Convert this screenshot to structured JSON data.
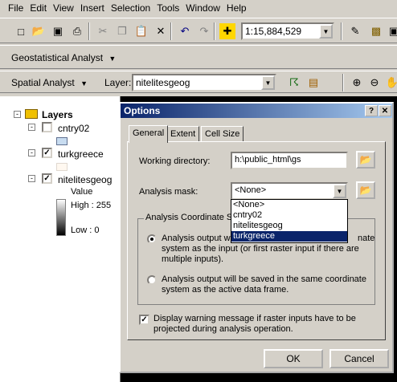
{
  "menu": [
    "File",
    "Edit",
    "View",
    "Insert",
    "Selection",
    "Tools",
    "Window",
    "Help"
  ],
  "toolbar": {
    "scale": "1:15,884,529",
    "geostat": "Geostatistical Analyst",
    "spatial": "Spatial Analyst",
    "layer_label": "Layer:",
    "layer_value": "nitelitesgeog"
  },
  "toc": {
    "title": "Layers",
    "layers": [
      "cntry02",
      "turkgreece",
      "nitelitesgeog"
    ],
    "value_label": "Value",
    "high": "High : 255",
    "low": "Low : 0"
  },
  "dialog": {
    "title": "Options",
    "tabs": [
      "General",
      "Extent",
      "Cell Size"
    ],
    "workdir_label": "Working directory:",
    "workdir_value": "h:\\public_html\\gs",
    "mask_label": "Analysis mask:",
    "mask_value": "<None>",
    "mask_options": [
      "<None>",
      "cntry02",
      "nitelitesgeog",
      "turkgreece"
    ],
    "coord_group": "Analysis Coordinate Sy",
    "radio1_a": "Analysis output wi",
    "radio1_b": "nate",
    "radio1_c": "system as the input (or first raster input if there are",
    "radio1_d": "multiple inputs).",
    "radio2_a": "Analysis output will be saved in the same coordinate",
    "radio2_b": "system as the active data frame.",
    "check_a": "Display warning message if raster inputs have to be",
    "check_b": "projected during analysis operation.",
    "ok": "OK",
    "cancel": "Cancel"
  }
}
